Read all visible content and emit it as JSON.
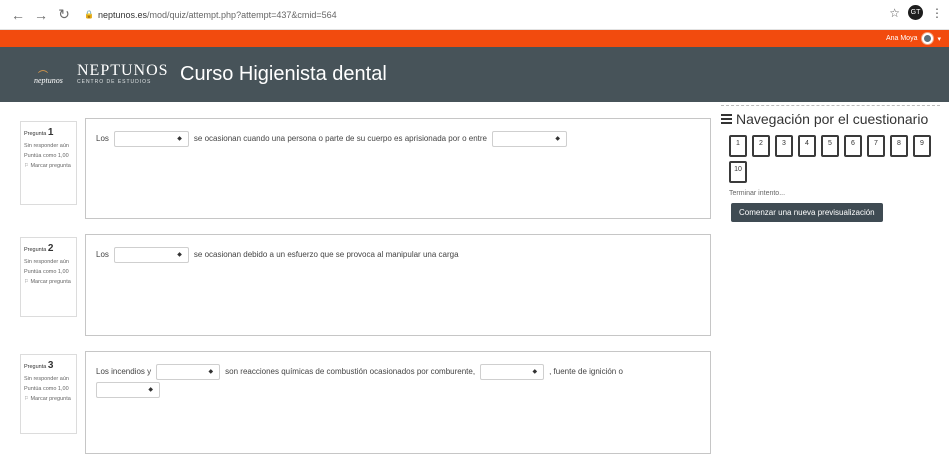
{
  "browser": {
    "url_host": "neptunos.es",
    "url_path": "/mod/quiz/attempt.php?attempt=437&cmid=564",
    "extension_label": "GT"
  },
  "topbar": {
    "user_name": "Ana Moya"
  },
  "header": {
    "logo_wordmark": "neptunos",
    "brand_name": "NEPTUNOS",
    "brand_subtitle": "CENTRO DE ESTUDIOS",
    "course_title": "Curso Higienista dental"
  },
  "questions": [
    {
      "number_label": "Pregunta",
      "number": "1",
      "status": "Sin responder aún",
      "score": "Puntúa como 1,00",
      "flag_label": "Marcar pregunta",
      "parts": [
        "Los",
        "se ocasionan cuando una persona o parte de su cuerpo es aprisionada por o entre"
      ]
    },
    {
      "number_label": "Pregunta",
      "number": "2",
      "status": "Sin responder aún",
      "score": "Puntúa como 1,00",
      "flag_label": "Marcar pregunta",
      "parts": [
        "Los",
        "se ocasionan debido a un esfuerzo que se provoca al manipular una carga"
      ]
    },
    {
      "number_label": "Pregunta",
      "number": "3",
      "status": "Sin responder aún",
      "score": "Puntúa como 1,00",
      "flag_label": "Marcar pregunta",
      "parts": [
        "Los incendios y",
        "son reacciones químicas de combustión ocasionados por comburente,",
        ", fuente de ignición o"
      ]
    }
  ],
  "sidebar": {
    "title": "Navegación por el cuestionario",
    "question_numbers": [
      "1",
      "2",
      "3",
      "4",
      "5",
      "6",
      "7",
      "8",
      "9",
      "10"
    ],
    "finish_link": "Terminar intento...",
    "preview_button": "Comenzar una nueva previsualización"
  },
  "colors": {
    "topbar": "#f24b0e",
    "header": "#475359",
    "button": "#3f4b53"
  }
}
